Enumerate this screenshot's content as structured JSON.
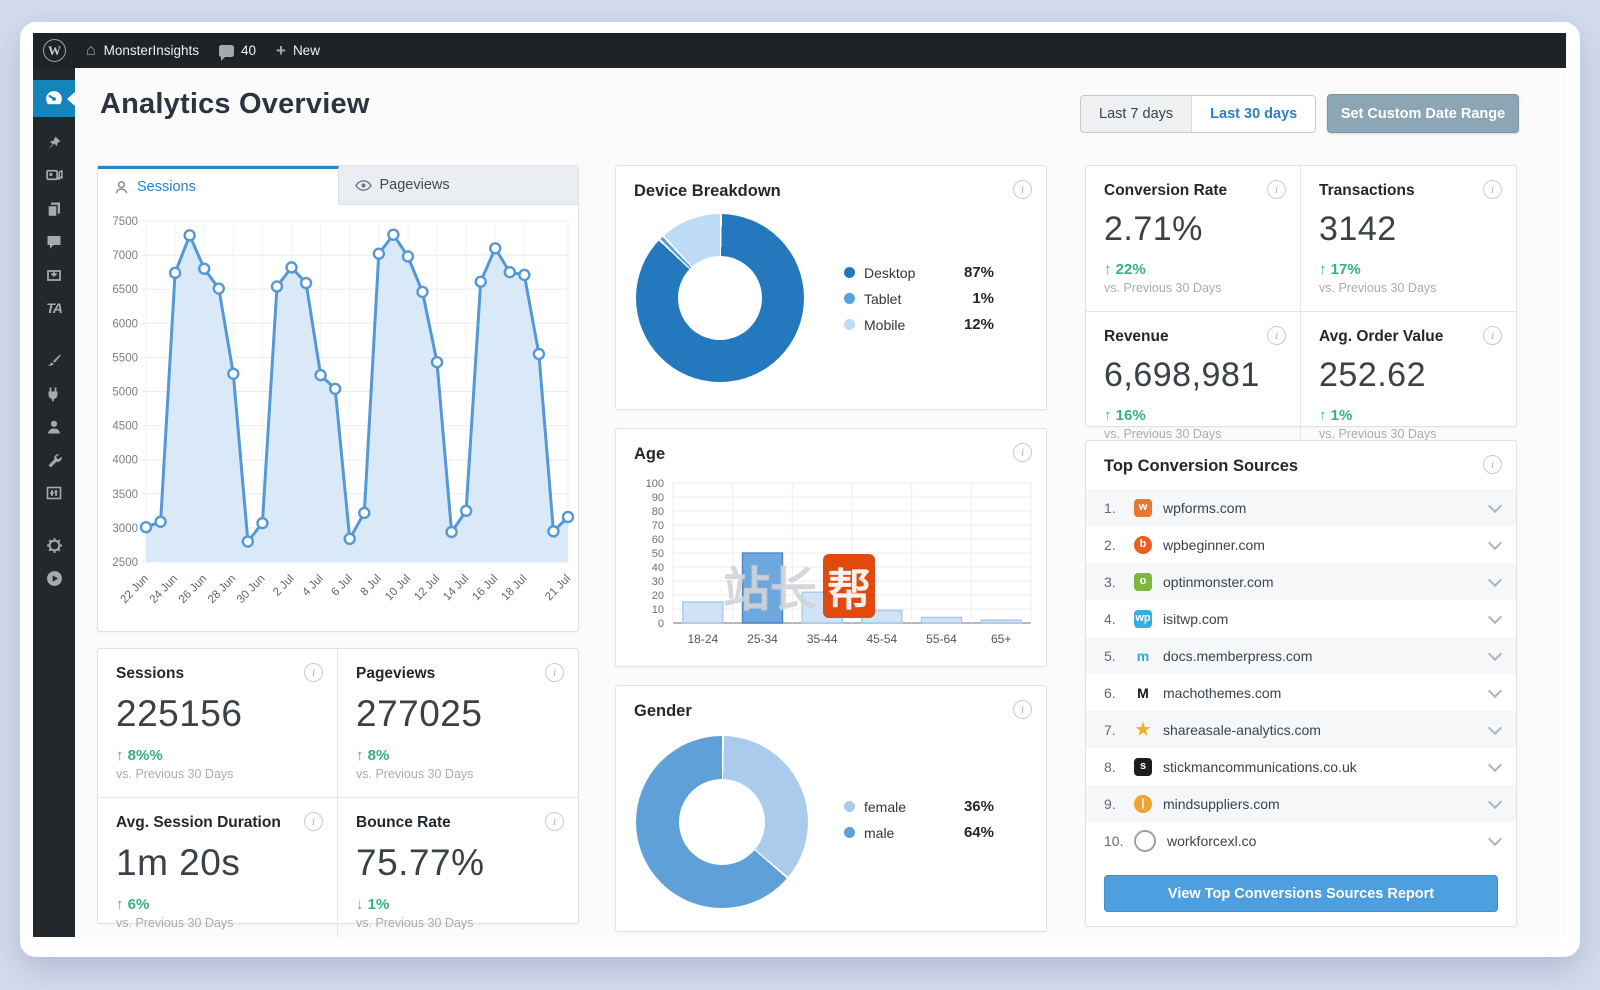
{
  "admin_bar": {
    "site": "MonsterInsights",
    "comments_count": "40",
    "new_label": "New"
  },
  "sidebar": {
    "items": [
      {
        "name": "dashboard",
        "active": true
      },
      {
        "name": "pin"
      },
      {
        "name": "media"
      },
      {
        "name": "pages"
      },
      {
        "name": "comments"
      },
      {
        "name": "download"
      },
      {
        "name": "ta-badge"
      },
      {
        "name": "brush",
        "gap": true
      },
      {
        "name": "plug"
      },
      {
        "name": "user"
      },
      {
        "name": "wrench"
      },
      {
        "name": "sliders"
      },
      {
        "name": "mascot",
        "gap": true
      },
      {
        "name": "play"
      }
    ]
  },
  "header": {
    "title": "Analytics Overview",
    "range_last7": "Last 7 days",
    "range_last30": "Last 30 days",
    "custom_range": "Set Custom Date Range"
  },
  "tabs": {
    "sessions": "Sessions",
    "pageviews": "Pageviews"
  },
  "chart_data": [
    {
      "type": "area",
      "title": "Sessions",
      "x": [
        "22 Jun",
        "23 Jun",
        "24 Jun",
        "25 Jun",
        "26 Jun",
        "27 Jun",
        "28 Jun",
        "29 Jun",
        "30 Jun",
        "1 Jul",
        "2 Jul",
        "3 Jul",
        "4 Jul",
        "5 Jul",
        "6 Jul",
        "7 Jul",
        "8 Jul",
        "9 Jul",
        "10 Jul",
        "11 Jul",
        "12 Jul",
        "13 Jul",
        "14 Jul",
        "15 Jul",
        "16 Jul",
        "17 Jul",
        "18 Jul",
        "19 Jul",
        "20 Jul",
        "21 Jul"
      ],
      "values": [
        3010,
        3090,
        6740,
        7290,
        6800,
        6510,
        5260,
        2800,
        3070,
        6540,
        6820,
        6590,
        5240,
        5040,
        2840,
        3220,
        7020,
        7300,
        6980,
        6460,
        5430,
        2940,
        3250,
        6610,
        7100,
        6750,
        6710,
        5550,
        2950,
        3160
      ],
      "label_indices": [
        0,
        2,
        4,
        6,
        8,
        10,
        12,
        14,
        16,
        18,
        20,
        22,
        24,
        26,
        29
      ],
      "ylim": [
        2500,
        7500
      ],
      "ytick": 500,
      "grid": true,
      "legend": "none"
    },
    {
      "type": "pie",
      "title": "Device Breakdown",
      "labels": [
        "Desktop",
        "Tablet",
        "Mobile"
      ],
      "values": [
        87,
        1,
        12
      ],
      "value_labels": [
        "87%",
        "1%",
        "12%"
      ],
      "colors": [
        "#2478be",
        "#55a1db",
        "#bedcf7"
      ],
      "legend": "right"
    },
    {
      "type": "bar",
      "title": "Age",
      "categories": [
        "18-24",
        "25-34",
        "35-44",
        "45-54",
        "55-64",
        "65+"
      ],
      "values": [
        15,
        50,
        22,
        9,
        4,
        2
      ],
      "highlight_index": 1,
      "ylim": [
        0,
        100
      ],
      "ytick": 10,
      "grid": true,
      "bar_color": "#cfe2f6",
      "bar_border": "#a9c8e8",
      "highlight_color": "#6da7dd",
      "highlight_border": "#4c87c3"
    },
    {
      "type": "pie",
      "title": "Gender",
      "labels": [
        "female",
        "male"
      ],
      "values": [
        36,
        64
      ],
      "value_labels": [
        "36%",
        "64%"
      ],
      "colors": [
        "#abcbed",
        "#5fa0d8"
      ],
      "legend": "right"
    }
  ],
  "stats_left": [
    {
      "label": "Sessions",
      "value": "225156",
      "delta": "8%%",
      "dir": "up",
      "note": "vs. Previous 30 Days"
    },
    {
      "label": "Pageviews",
      "value": "277025",
      "delta": "8%",
      "dir": "up",
      "note": "vs. Previous 30 Days"
    },
    {
      "label": "Avg. Session Duration",
      "value": "1m 20s",
      "delta": "6%",
      "dir": "up",
      "note": "vs. Previous 30 Days"
    },
    {
      "label": "Bounce Rate",
      "value": "75.77%",
      "delta": "1%",
      "dir": "down",
      "note": "vs. Previous 30 Days"
    }
  ],
  "stats_right": [
    {
      "label": "Conversion Rate",
      "value": "2.71%",
      "delta": "22%",
      "dir": "up",
      "note": "vs. Previous 30 Days"
    },
    {
      "label": "Transactions",
      "value": "3142",
      "delta": "17%",
      "dir": "up",
      "note": "vs. Previous 30 Days"
    },
    {
      "label": "Revenue",
      "value": "6,698,981",
      "delta": "16%",
      "dir": "up",
      "note": "vs. Previous 30 Days"
    },
    {
      "label": "Avg. Order Value",
      "value": "252.62",
      "delta": "1%",
      "dir": "up",
      "note": "vs. Previous 30 Days"
    }
  ],
  "top_sources": {
    "title": "Top Conversion Sources",
    "button": "View Top Conversions Sources Report",
    "items": [
      {
        "rank": "1.",
        "domain": "wpforms.com",
        "icon": {
          "name": "favicon-wpforms",
          "shape": "rounded",
          "bg": "#e8772f",
          "fg": "#ffffff",
          "glyph": "w"
        }
      },
      {
        "rank": "2.",
        "domain": "wpbeginner.com",
        "icon": {
          "name": "favicon-wpbeginner",
          "shape": "circle",
          "bg": "#ee5c23",
          "fg": "#ffffff",
          "glyph": "b"
        }
      },
      {
        "rank": "3.",
        "domain": "optinmonster.com",
        "icon": {
          "name": "favicon-optinmonster",
          "shape": "rounded",
          "bg": "#7fb63d",
          "fg": "#ffffff",
          "glyph": "o"
        }
      },
      {
        "rank": "4.",
        "domain": "isitwp.com",
        "icon": {
          "name": "favicon-isitwp",
          "shape": "rounded",
          "bg": "#35aee2",
          "fg": "#ffffff",
          "glyph": "wp"
        }
      },
      {
        "rank": "5.",
        "domain": "docs.memberpress.com",
        "icon": {
          "name": "favicon-memberpress",
          "shape": "plain",
          "bg": "",
          "fg": "#35a6dc",
          "glyph": "m"
        }
      },
      {
        "rank": "6.",
        "domain": "machothemes.com",
        "icon": {
          "name": "favicon-machothemes",
          "shape": "plain",
          "bg": "",
          "fg": "#15161a",
          "glyph": "M"
        }
      },
      {
        "rank": "7.",
        "domain": "shareasale-analytics.com",
        "icon": {
          "name": "favicon-shareasale-star",
          "shape": "star",
          "bg": "",
          "fg": "#f2b01e",
          "glyph": "★"
        }
      },
      {
        "rank": "8.",
        "domain": "stickmancommunications.co.uk",
        "icon": {
          "name": "favicon-stickman",
          "shape": "rounded",
          "bg": "#1d1d1b",
          "fg": "#ffffff",
          "glyph": "s"
        }
      },
      {
        "rank": "9.",
        "domain": "mindsuppliers.com",
        "icon": {
          "name": "favicon-mindsuppliers",
          "shape": "circle",
          "bg": "#f0a330",
          "fg": "#ffffff",
          "glyph": "|"
        }
      },
      {
        "rank": "10.",
        "domain": "workforcexl.co",
        "icon": {
          "name": "favicon-workforcexl-globe",
          "shape": "ring",
          "bg": "",
          "fg": "#9aa1a8",
          "glyph": ""
        }
      }
    ]
  },
  "watermark": {
    "part1": "站长",
    "part2": "帮"
  },
  "colors": {
    "accent_blue": "#2b82c9",
    "green": "#33b37a",
    "chart_line": "#5598d6",
    "chart_fill": "#d9e9f8",
    "active_menu": "#1484bb",
    "button_blue": "#4d9fdf",
    "custom_button": "#8ca6b5",
    "adminbar": "#1d2327"
  }
}
